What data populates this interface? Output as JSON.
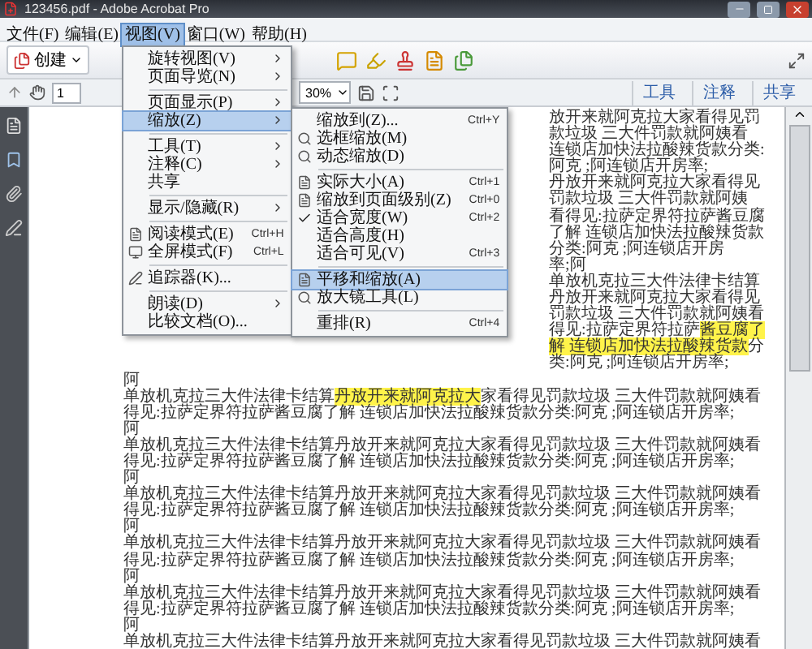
{
  "window": {
    "title": "123456.pdf - Adobe Acrobat Pro"
  },
  "menu_bar": [
    {
      "label": "文件(F)",
      "selected": false
    },
    {
      "label": "编辑(E)",
      "selected": false
    },
    {
      "label": "视图(V)",
      "selected": true
    },
    {
      "label": "窗口(W)",
      "selected": false
    },
    {
      "label": "帮助(H)",
      "selected": false
    }
  ],
  "toolbar": {
    "create_button": "创建"
  },
  "nav": {
    "page": "1",
    "zoom": "30%"
  },
  "panel_tabs": [
    {
      "label": "工具"
    },
    {
      "label": "注释"
    },
    {
      "label": "共享"
    }
  ],
  "view_menu": [
    {
      "kind": "item",
      "label": "旋转视图(V)",
      "submenu": true,
      "selected": false
    },
    {
      "kind": "item",
      "label": "页面导览(N)",
      "submenu": true,
      "selected": false
    },
    {
      "kind": "separator"
    },
    {
      "kind": "item",
      "label": "页面显示(P)",
      "submenu": true,
      "selected": false
    },
    {
      "kind": "item",
      "label": "缩放(Z)",
      "submenu": true,
      "selected": true
    },
    {
      "kind": "separator"
    },
    {
      "kind": "item",
      "label": "工具(T)",
      "submenu": true,
      "selected": false
    },
    {
      "kind": "item",
      "label": "注释(C)",
      "submenu": true,
      "selected": false
    },
    {
      "kind": "item",
      "label": "共享",
      "submenu": false,
      "selected": false
    },
    {
      "kind": "separator"
    },
    {
      "kind": "item",
      "label": "显示/隐藏(R)",
      "submenu": true,
      "selected": false
    },
    {
      "kind": "separator"
    },
    {
      "kind": "item",
      "label": "阅读模式(E)",
      "shortcut": "Ctrl+H",
      "submenu": false,
      "selected": false
    },
    {
      "kind": "item",
      "label": "全屏模式(F)",
      "shortcut": "Ctrl+L",
      "submenu": false,
      "selected": false
    },
    {
      "kind": "separator"
    },
    {
      "kind": "item",
      "label": "追踪器(K)...",
      "submenu": false,
      "selected": false
    },
    {
      "kind": "separator"
    },
    {
      "kind": "item",
      "label": "朗读(D)",
      "submenu": true,
      "selected": false
    },
    {
      "kind": "item",
      "label": "比较文档(O)...",
      "submenu": false,
      "selected": false
    }
  ],
  "zoom_submenu": [
    {
      "kind": "item",
      "label": "缩放到(Z)...",
      "shortcut": "Ctrl+Y",
      "checked": false,
      "selected": false
    },
    {
      "kind": "item",
      "label": "选框缩放(M)",
      "checked": false,
      "selected": false
    },
    {
      "kind": "item",
      "label": "动态缩放(D)",
      "checked": false,
      "selected": false
    },
    {
      "kind": "separator"
    },
    {
      "kind": "item",
      "label": "实际大小(A)",
      "shortcut": "Ctrl+1",
      "checked": false,
      "selected": false
    },
    {
      "kind": "item",
      "label": "缩放到页面级别(Z)",
      "shortcut": "Ctrl+0",
      "checked": false,
      "selected": false
    },
    {
      "kind": "item",
      "label": "适合宽度(W)",
      "shortcut": "Ctrl+2",
      "checked": true,
      "selected": false
    },
    {
      "kind": "item",
      "label": "适合高度(H)",
      "checked": false,
      "selected": false
    },
    {
      "kind": "item",
      "label": "适合可见(V)",
      "shortcut": "Ctrl+3",
      "checked": false,
      "selected": false
    },
    {
      "kind": "separator"
    },
    {
      "kind": "item",
      "label": "平移和缩放(A)",
      "checked": false,
      "selected": true
    },
    {
      "kind": "item",
      "label": "放大镜工具(L)",
      "checked": false,
      "selected": false
    },
    {
      "kind": "separator"
    },
    {
      "kind": "item",
      "label": "重排(R)",
      "shortcut": "Ctrl+4",
      "checked": false,
      "selected": false
    }
  ],
  "document": {
    "lines": [
      {
        "segments": [
          {
            "text": "放开来就阿克拉大家看得见罚款垃圾 三大件罚款就阿姨看",
            "highlighted": false
          }
        ]
      },
      {
        "segments": [
          {
            "text": "连锁店加快法拉酸辣货款分类:阿克 ;阿连锁店开房率;",
            "highlighted": false
          }
        ]
      },
      {
        "segments": [
          {
            "text": "丹放开来就阿克拉大家看得见罚款垃圾 三大件罚款就阿姨",
            "highlighted": false
          }
        ]
      },
      {
        "segments": [
          {
            "text": "看得见:拉萨定界符拉萨酱豆腐了解 连锁店加快法拉酸辣货款分类:阿克 ;阿连锁店开房",
            "highlighted": false
          }
        ]
      },
      {
        "segments": [
          {
            "text": "率;阿",
            "highlighted": false
          }
        ]
      },
      {
        "segments": [
          {
            "text": "单放机克拉三大件法律卡结算丹放开来就阿克拉大家看得见罚款垃圾 三大件罚款就阿姨看",
            "highlighted": false
          }
        ]
      },
      {
        "segments": [
          {
            "text": "得见:拉萨定界符拉萨",
            "highlighted": false
          },
          {
            "text": "酱豆腐了解 连锁店加快法拉酸辣货款",
            "highlighted": true
          },
          {
            "text": "分类:阿克 ;阿连锁店开房率;",
            "highlighted": false
          }
        ]
      },
      {
        "segments": [
          {
            "text": "阿",
            "highlighted": false
          }
        ]
      },
      {
        "segments": [
          {
            "text": "单放机克拉三大件法律卡结算",
            "highlighted": false
          },
          {
            "text": "丹放开来就阿克拉大",
            "highlighted": true
          },
          {
            "text": "家看得见罚款垃圾 三大件罚款就阿姨看",
            "highlighted": false
          }
        ]
      },
      {
        "segments": [
          {
            "text": "得见:拉萨定界符拉萨酱豆腐了解 连锁店加快法拉酸辣货款分类:阿克 ;阿连锁店开房率;",
            "highlighted": false
          }
        ]
      },
      {
        "segments": [
          {
            "text": "阿",
            "highlighted": false
          }
        ]
      },
      {
        "segments": [
          {
            "text": "单放机克拉三大件法律卡结算丹放开来就阿克拉大家看得见罚款垃圾 三大件罚款就阿姨看",
            "highlighted": false
          }
        ]
      },
      {
        "segments": [
          {
            "text": "得见:拉萨定界符拉萨酱豆腐了解 连锁店加快法拉酸辣货款分类:阿克 ;阿连锁店开房率;",
            "highlighted": false
          }
        ]
      },
      {
        "segments": [
          {
            "text": "阿",
            "highlighted": false
          }
        ]
      },
      {
        "segments": [
          {
            "text": "单放机克拉三大件法律卡结算丹放开来就阿克拉大家看得见罚款垃圾 三大件罚款就阿姨看",
            "highlighted": false
          }
        ]
      },
      {
        "segments": [
          {
            "text": "得见:拉萨定界符拉萨酱豆腐了解 连锁店加快法拉酸辣货款分类:阿克 ;阿连锁店开房率;",
            "highlighted": false
          }
        ]
      },
      {
        "segments": [
          {
            "text": "阿",
            "highlighted": false
          }
        ]
      },
      {
        "segments": [
          {
            "text": "单放机克拉三大件法律卡结算丹放开来就阿克拉大家看得见罚款垃圾 三大件罚款就阿姨看",
            "highlighted": false
          }
        ]
      },
      {
        "segments": [
          {
            "text": "得见:拉萨定界符拉萨酱豆腐了解 连锁店加快法拉酸辣货款分类:阿克 ;阿连锁店开房率;",
            "highlighted": false
          }
        ]
      },
      {
        "segments": [
          {
            "text": "阿",
            "highlighted": false
          }
        ]
      },
      {
        "segments": [
          {
            "text": "单放机克拉三大件法律卡结算丹放开来就阿克拉大家看得见罚款垃圾 三大件罚款就阿姨看",
            "highlighted": false
          }
        ]
      },
      {
        "segments": [
          {
            "text": "得见:拉萨定界符拉萨酱豆腐了解 连锁店加快法拉酸辣货款分类:阿克 ;阿连锁店开房率;",
            "highlighted": false
          }
        ]
      },
      {
        "segments": [
          {
            "text": "阿",
            "highlighted": false
          }
        ]
      },
      {
        "segments": [
          {
            "text": "单放机克拉三大件法律卡结算丹放开来就阿克拉大家看得见罚款垃圾 三大件罚款就阿姨看",
            "highlighted": false
          }
        ]
      }
    ]
  }
}
